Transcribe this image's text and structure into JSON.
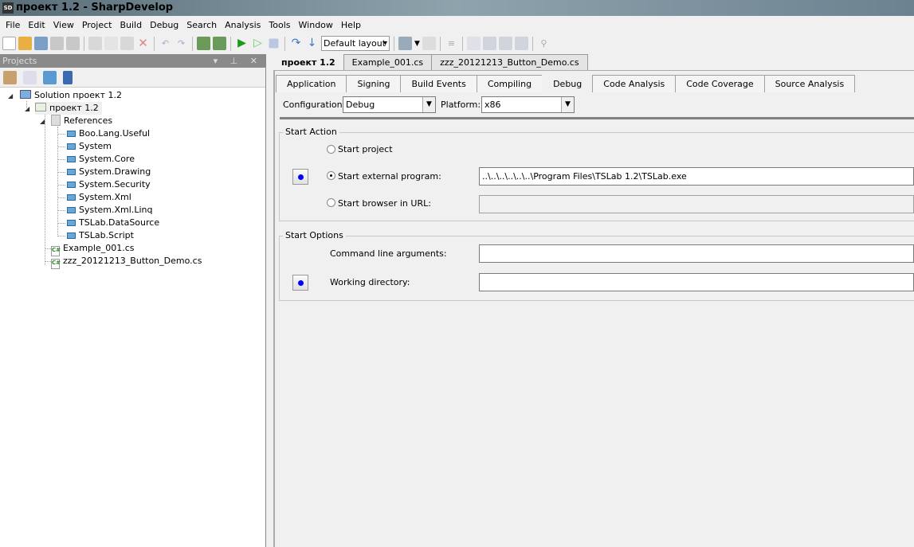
{
  "window": {
    "title": "проект 1.2 - SharpDevelop",
    "icon_text": "SD"
  },
  "menu": [
    "File",
    "Edit",
    "View",
    "Project",
    "Build",
    "Debug",
    "Search",
    "Analysis",
    "Tools",
    "Window",
    "Help"
  ],
  "toolbar": {
    "layout_value": "Default layout"
  },
  "projects_panel": {
    "title": "Projects",
    "tree": {
      "solution": "Solution проект 1.2",
      "project": "проект 1.2",
      "references_label": "References",
      "references": [
        "Boo.Lang.Useful",
        "System",
        "System.Core",
        "System.Drawing",
        "System.Security",
        "System.Xml",
        "System.Xml.Linq",
        "TSLab.DataSource",
        "TSLab.Script"
      ],
      "files": [
        "Example_001.cs",
        "zzz_20121213_Button_Demo.cs"
      ]
    }
  },
  "doc_tabs": [
    "проект 1.2",
    "Example_001.cs",
    "zzz_20121213_Button_Demo.cs"
  ],
  "prop_tabs": [
    "Application",
    "Signing",
    "Build Events",
    "Compiling",
    "Debug",
    "Code Analysis",
    "Code Coverage",
    "Source Analysis"
  ],
  "active_prop_tab": "Debug",
  "config": {
    "configuration_label": "Configuration:",
    "configuration_value": "Debug",
    "platform_label": "Platform:",
    "platform_value": "x86"
  },
  "start_action": {
    "title": "Start Action",
    "start_project": "Start project",
    "start_external": "Start external program:",
    "external_path": "..\\..\\..\\..\\..\\..\\Program Files\\TSLab 1.2\\TSLab.exe",
    "start_browser": "Start browser in URL:",
    "browser_url": "",
    "selected": "Start external program:"
  },
  "start_options": {
    "title": "Start Options",
    "cmd_label": "Command line arguments:",
    "cmd_value": "",
    "workdir_label": "Working directory:",
    "workdir_value": ""
  }
}
